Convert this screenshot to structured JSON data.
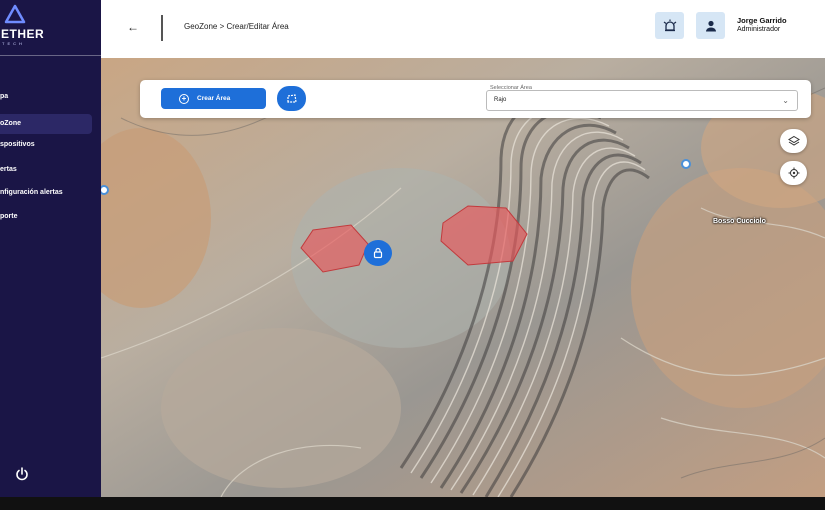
{
  "sidebar": {
    "logo_text": "ETHER",
    "logo_sub": "TECH",
    "items": [
      {
        "label": "pa",
        "active": false
      },
      {
        "label": "oZone",
        "active": true
      },
      {
        "label": "spositivos",
        "active": false
      },
      {
        "label": "ertas",
        "active": false
      },
      {
        "label": "nfiguración alertas",
        "active": false
      },
      {
        "label": "porte",
        "active": false
      }
    ],
    "power_icon": "power-icon"
  },
  "header": {
    "back_icon": "←",
    "breadcrumb": "GeoZone > Crear/Editar Área",
    "user_name": "Jorge Garrido",
    "user_role": "Administrador"
  },
  "toolbar": {
    "create_label": "Crear Área",
    "select_legend": "Seleccionar Área",
    "select_value": "Rajo"
  },
  "map": {
    "place_label": "Bosso Cucciolo",
    "polygon_color": "#e8575a"
  },
  "colors": {
    "sidebar_bg": "#1a1546",
    "accent": "#1e6fd9",
    "header_btn_bg": "#d6e6f5"
  }
}
